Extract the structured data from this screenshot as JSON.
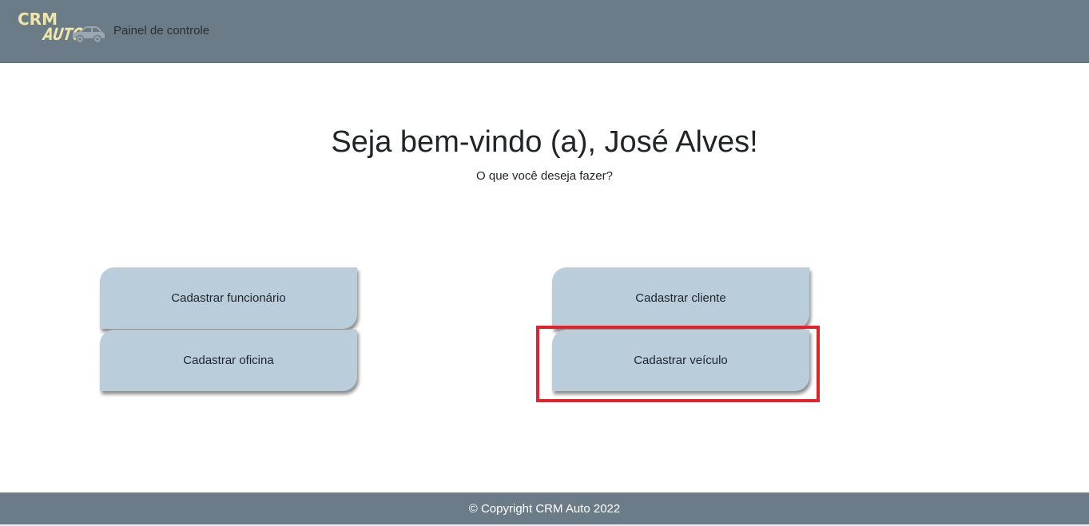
{
  "navbar": {
    "logo_line1": "CRM",
    "logo_line2": "AUTO",
    "logo_icon": "car-icon",
    "title": "Painel de controle",
    "background_color": "#6b7b87"
  },
  "main": {
    "welcome": "Seja bem-vindo (a), José Alves!",
    "prompt": "O que você deseja fazer?",
    "actions": [
      {
        "label": "Cadastrar funcionário"
      },
      {
        "label": "Cadastrar oficina"
      },
      {
        "label": "Cadastrar cliente"
      },
      {
        "label": "Cadastrar veículo",
        "highlighted": true
      }
    ],
    "button_color": "#bacdda",
    "highlight_color": "#e3222b"
  },
  "footer": {
    "text": "© Copyright CRM Auto 2022"
  }
}
